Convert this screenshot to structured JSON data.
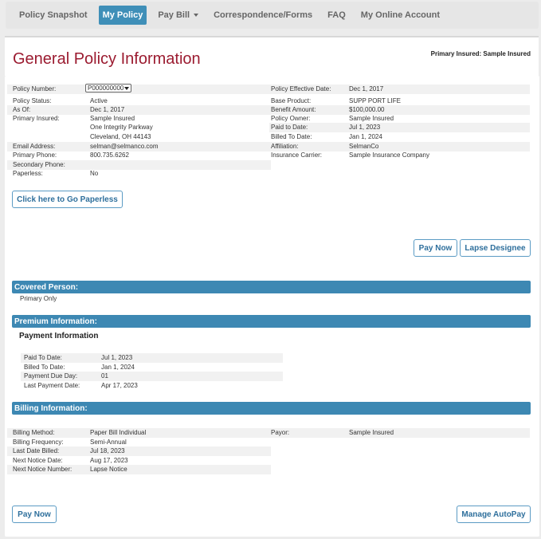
{
  "nav": {
    "items": [
      {
        "label": "Policy Snapshot",
        "active": false
      },
      {
        "label": "My Policy",
        "active": true
      },
      {
        "label": "Pay Bill",
        "active": false,
        "dropdown": true
      },
      {
        "label": "Correspondence/Forms",
        "active": false
      },
      {
        "label": "FAQ",
        "active": false
      },
      {
        "label": "My Online Account",
        "active": false
      }
    ]
  },
  "page": {
    "title": "General Policy Information",
    "primary_insured_top": "Primary Insured: Sample Insured"
  },
  "general": {
    "left": [
      {
        "label": "Policy Number:",
        "value": "P000000000",
        "select": true
      },
      {
        "label": "Policy Status:",
        "value": "Active"
      },
      {
        "label": "As Of:",
        "value": "Dec 1, 2017"
      },
      {
        "label": "Primary Insured:",
        "value": "Sample Insured"
      },
      {
        "label": "",
        "value": "One Integrity Parkway"
      },
      {
        "label": "",
        "value": "Cleveland, OH 44143"
      },
      {
        "label": "Email Address:",
        "value": "selman@selmanco.com"
      },
      {
        "label": "Primary Phone:",
        "value": "800.735.6262"
      },
      {
        "label": "Secondary Phone:",
        "value": ""
      },
      {
        "label": "Paperless:",
        "value": "No"
      }
    ],
    "right": [
      {
        "label": "Policy Effective Date:",
        "value": "Dec 1, 2017"
      },
      {
        "label": "Base Product:",
        "value": "SUPP PORT LIFE"
      },
      {
        "label": "Benefit Amount:",
        "value": "$100,000.00"
      },
      {
        "label": "Policy Owner:",
        "value": "Sample Insured"
      },
      {
        "label": "Paid to Date:",
        "value": "Jul 1, 2023"
      },
      {
        "label": "Billed To Date:",
        "value": "Jan 1, 2024"
      },
      {
        "label": "Affiliation:",
        "value": "SelmanCo"
      },
      {
        "label": "Insurance Carrier:",
        "value": "Sample Insurance Company"
      }
    ]
  },
  "buttons": {
    "paperless": "Click here to Go Paperless",
    "pay_now": "Pay Now",
    "lapse_designee": "Lapse Designee",
    "pay_now_bottom": "Pay Now",
    "manage_autopay": "Manage AutoPay"
  },
  "covered": {
    "title": "Covered Person:",
    "value": "Primary Only"
  },
  "premium": {
    "title": "Premium Information:",
    "subtitle": "Payment Information",
    "rows": [
      {
        "label": "Paid To Date:",
        "value": "Jul 1, 2023"
      },
      {
        "label": "Billed To Date:",
        "value": "Jan 1, 2024"
      },
      {
        "label": "Payment Due Day:",
        "value": "01"
      },
      {
        "label": "Last Payment Date:",
        "value": "Apr 17, 2023"
      }
    ]
  },
  "billing": {
    "title": "Billing Information:",
    "left": [
      {
        "label": "Billing Method:",
        "value": "Paper Bill Individual"
      },
      {
        "label": "Billing Frequency:",
        "value": "Semi-Annual"
      },
      {
        "label": "Last Date Billed:",
        "value": "Jul 18, 2023"
      },
      {
        "label": "Next Notice Date:",
        "value": "Aug 17, 2023"
      },
      {
        "label": "Next Notice Number:",
        "value": "Lapse Notice"
      }
    ],
    "right": [
      {
        "label": "Payor:",
        "value": "Sample Insured"
      }
    ]
  },
  "colors": {
    "nav_active": "#3f8fb8",
    "title": "#9b1b30",
    "section_bar": "#3d88b3",
    "button_text": "#2e6f9c"
  }
}
